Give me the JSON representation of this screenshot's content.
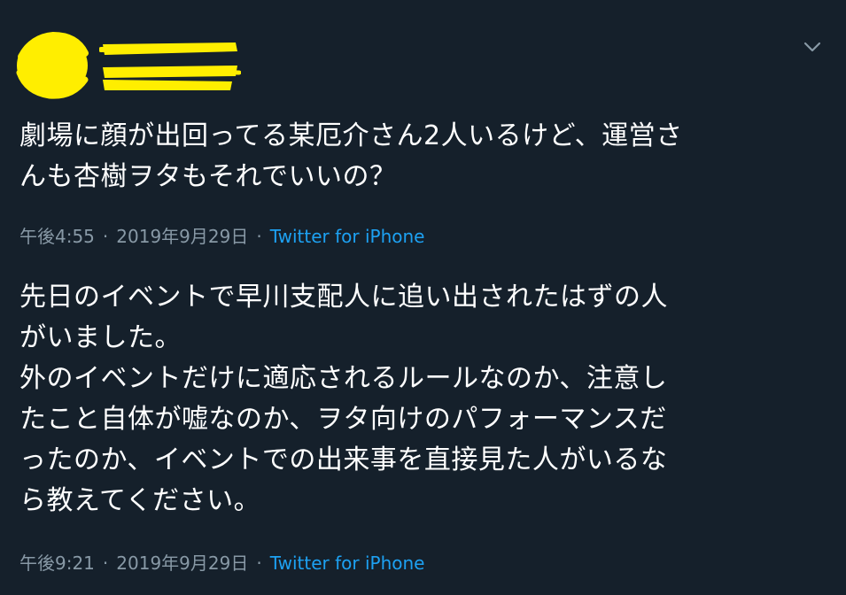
{
  "tweet1": {
    "text_lines": [
      "劇場に顔が出回ってる某厄介さん2人いるけど、運営さ",
      "んも杏樹ヲタもそれでいいの？"
    ],
    "time": "午後4:55",
    "date": "2019年9月29日",
    "separator": "·",
    "source": "Twitter for iPhone"
  },
  "tweet2": {
    "text_lines": [
      "先日のイベントで早川支配人に追い出されたはずの人",
      "がいました。",
      "外のイベントだけに適応されるルールなのか、注意し",
      "たこと自体が嘘なのか、ヲタ向けのパフォーマンスだ",
      "ったのか、イベントでの出来事を直接見た人がいるな",
      "ら教えてください。"
    ],
    "time": "午後9:21",
    "date": "2019年9月29日",
    "separator": "·",
    "source": "Twitter for iPhone"
  },
  "colors": {
    "background": "#15202b",
    "text": "#ffffff",
    "meta": "#8899a6",
    "link": "#1da1f2",
    "redaction": "#ffee00"
  },
  "icons": {
    "avatar": "redacted-avatar",
    "caret": "chevron-down-icon"
  }
}
